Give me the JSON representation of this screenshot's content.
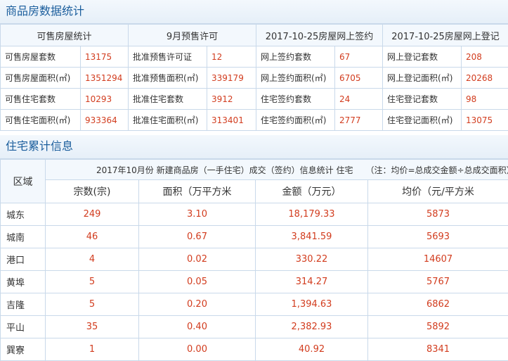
{
  "section1": {
    "title": "商品房数据统计",
    "columns": [
      "可售房屋统计",
      "9月预售许可",
      "2017-10-25房屋网上签约",
      "2017-10-25房屋网上登记"
    ],
    "rows": [
      [
        [
          "可售房屋套数",
          "13175"
        ],
        [
          "批准预售许可证",
          "12"
        ],
        [
          "网上签约套数",
          "67"
        ],
        [
          "网上登记套数",
          "208"
        ]
      ],
      [
        [
          "可售房屋面积(㎡)",
          "1351294"
        ],
        [
          "批准预售面积(㎡)",
          "339179"
        ],
        [
          "网上签约面积(㎡)",
          "6705"
        ],
        [
          "网上登记面积(㎡)",
          "20268"
        ]
      ],
      [
        [
          "可售住宅套数",
          "10293"
        ],
        [
          "批准住宅套数",
          "3912"
        ],
        [
          "住宅签约套数",
          "24"
        ],
        [
          "住宅登记套数",
          "98"
        ]
      ],
      [
        [
          "可售住宅面积(㎡)",
          "933364"
        ],
        [
          "批准住宅面积(㎡)",
          "313401"
        ],
        [
          "住宅签约面积(㎡)",
          "2777"
        ],
        [
          "住宅登记面积(㎡)",
          "13075"
        ]
      ]
    ]
  },
  "section2": {
    "title": "住宅累计信息",
    "region_header": "区域",
    "caption": "2017年10月份 新建商品房（一手住宅）成交（签约）信息统计 住宅",
    "note": "（注：均价=总成交金额÷总成交面积）",
    "columns": [
      "宗数(宗)",
      "面积（万平方米",
      "金额（万元）",
      "均价（元/平方米"
    ],
    "rows": [
      [
        "城东",
        "249",
        "3.10",
        "18,179.33",
        "5873"
      ],
      [
        "城南",
        "46",
        "0.67",
        "3,841.59",
        "5693"
      ],
      [
        "港口",
        "4",
        "0.02",
        "330.22",
        "14607"
      ],
      [
        "黄埠",
        "5",
        "0.05",
        "314.27",
        "5767"
      ],
      [
        "吉隆",
        "5",
        "0.20",
        "1,394.63",
        "6862"
      ],
      [
        "平山",
        "35",
        "0.40",
        "2,382.93",
        "5892"
      ],
      [
        "巽寮",
        "1",
        "0.00",
        "40.92",
        "8341"
      ]
    ]
  }
}
